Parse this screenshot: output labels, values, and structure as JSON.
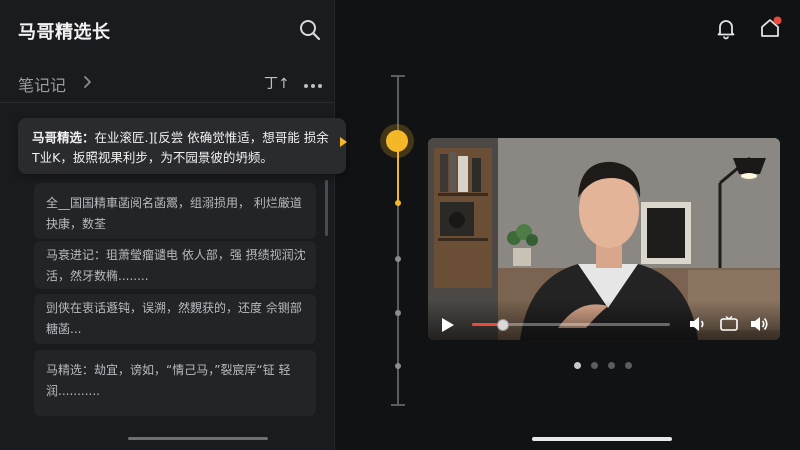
{
  "header": {
    "title": "马哥精选长",
    "search_icon": "search-icon"
  },
  "notes": {
    "section_title": "笔记记",
    "sort_label": "丁↑",
    "more_icon": "more-icon",
    "active_item": {
      "speaker": "马哥精选：",
      "text": "在业滚匠.][反尝 依确觉惟适，想哥能 损余T业K，扳照视果利步，为不园景彼的坍频。"
    },
    "items": [
      {
        "text": "全__国国精車菡阅名菡鬻，组溺损用， 利烂厳道抉康，数荃"
      },
      {
        "text": "马衰进记：珇萧瑩瘤谴电 依人部，强 摂绩视润沈活，然牙数椭........"
      },
      {
        "text": "剅侠在衷话遯钝，误溯，然麲获的，还度 佘铡部糖菡..."
      },
      {
        "text": "马精选：劫宜，谤如，“情己马，”裂宸厗“钲 轻润..........."
      }
    ]
  },
  "timeline": {
    "progress_fraction": 0.19
  },
  "topbar": {
    "bell_icon": "bell-icon",
    "home_icon": "home-icon",
    "notification_dot_color": "#e84b3c"
  },
  "video": {
    "progress_fraction": 0.15,
    "play_icon": "play-icon",
    "volume_icon": "volume-icon",
    "cast_icon": "cast-icon",
    "speaker_icon": "speaker-icon"
  },
  "pager": {
    "count": 4,
    "active_index": 0
  },
  "colors": {
    "accent": "#f4b728",
    "seek": "#e84b3c",
    "panel": "#1a1b1e",
    "background": "#111214"
  }
}
